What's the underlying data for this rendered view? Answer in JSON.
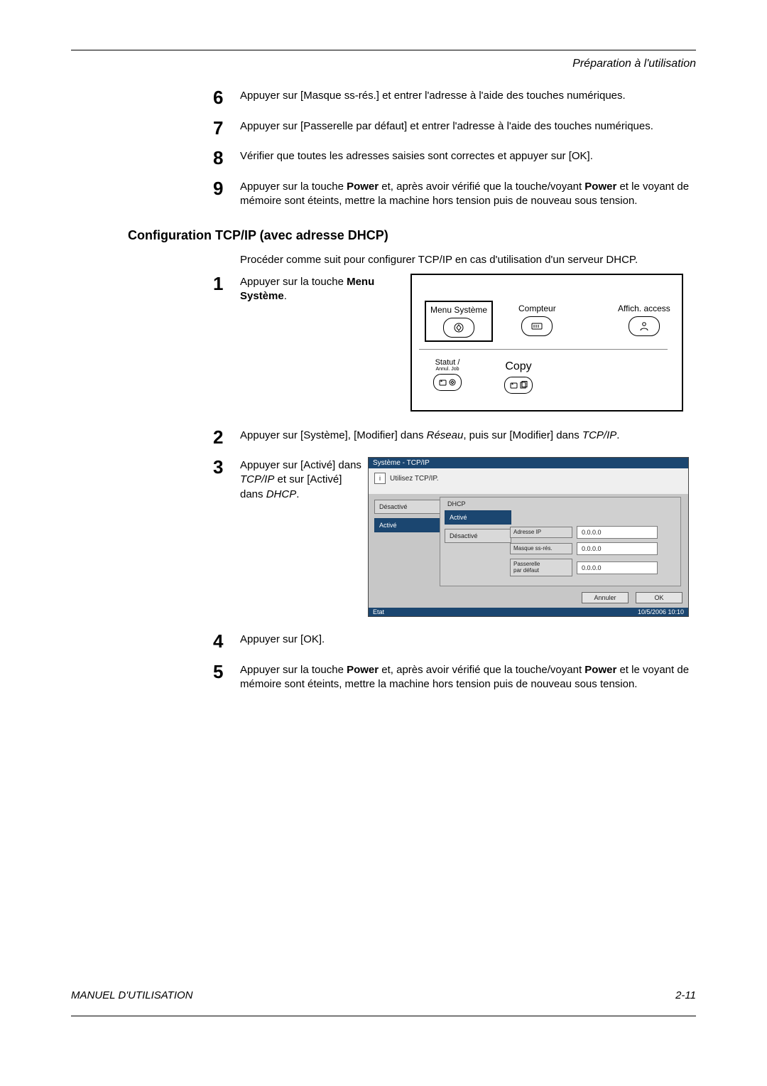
{
  "header": {
    "section": "Préparation à l'utilisation"
  },
  "steps_top": {
    "s6": {
      "num": "6",
      "text": "Appuyer sur [Masque ss-rés.] et entrer l'adresse à l'aide des touches numériques."
    },
    "s7": {
      "num": "7",
      "text": "Appuyer sur [Passerelle par défaut] et entrer l'adresse à l'aide des touches numériques."
    },
    "s8": {
      "num": "8",
      "text": "Vérifier que toutes les adresses saisies sont correctes et appuyer sur [OK]."
    },
    "s9": {
      "num": "9",
      "t1": "Appuyer sur la touche ",
      "b1": "Power",
      "t2": " et, après avoir vérifié que la touche/voyant ",
      "b2": "Power",
      "t3": " et le voyant de mémoire sont éteints, mettre la machine hors tension puis de nouveau sous tension."
    }
  },
  "section_title": "Configuration TCP/IP (avec adresse DHCP)",
  "intro": "Procéder comme suit pour configurer TCP/IP en cas d'utilisation d'un serveur DHCP.",
  "steps_dhcp": {
    "s1": {
      "num": "1",
      "t1": "Appuyer sur la touche ",
      "b1": "Menu Système",
      "t2": "."
    },
    "s2": {
      "num": "2",
      "t1": "Appuyer sur [Système], [Modifier] dans ",
      "i1": "Réseau",
      "t2": ", puis sur [Modifier] dans ",
      "i2": "TCP/IP",
      "t3": "."
    },
    "s3": {
      "num": "3",
      "t1": "Appuyer sur [Activé] dans ",
      "i1": "TCP/IP",
      "t2": " et sur [Activé] dans ",
      "i2": "DHCP",
      "t3": "."
    },
    "s4": {
      "num": "4",
      "text": "Appuyer sur [OK]."
    },
    "s5": {
      "num": "5",
      "t1": "Appuyer sur la touche ",
      "b1": "Power",
      "t2": " et, après avoir vérifié que la touche/voyant ",
      "b2": "Power",
      "t3": " et le voyant de mémoire sont éteints, mettre la machine hors tension puis de nouveau sous tension."
    }
  },
  "panel": {
    "menu_systeme": "Menu Système",
    "compteur": "Compteur",
    "affich": "Affich. access",
    "statut": "Statut /",
    "annul": "Annul. Job",
    "copy": "Copy"
  },
  "screen": {
    "title": "Système - TCP/IP",
    "info": "Utilisez TCP/IP.",
    "tcp_desactive": "Désactivé",
    "tcp_active": "Activé",
    "dhcp_label": "DHCP",
    "dhcp_active": "Activé",
    "dhcp_desactive": "Désactivé",
    "field_ip": "Adresse IP",
    "field_mask": "Masque ss-rés.",
    "field_gw_l1": "Passerelle",
    "field_gw_l2": "par défaut",
    "val_zero": "0.0.0.0",
    "cancel": "Annuler",
    "ok": "OK",
    "statusbar": "Etat",
    "datetime": "10/5/2006    10:10"
  },
  "footer": {
    "left": "MANUEL D'UTILISATION",
    "right": "2-11"
  }
}
